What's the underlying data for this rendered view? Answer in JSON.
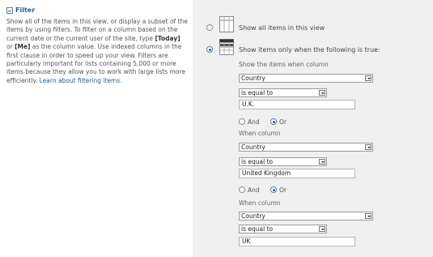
{
  "left": {
    "title": "Filter",
    "description_parts": [
      "Show all of the items in this view, or display a subset of the items by using filters. To filter on a column based on the current date or the current user of the site, type ",
      "[Today]",
      " or ",
      "[Me]",
      " as the column value. Use indexed columns in the first clause in order to speed up your view. Filters are particularly important for lists containing 5,000 or more items because they allow you to work with large lists more efficiently. "
    ],
    "link_text": "Learn about filtering items."
  },
  "options": {
    "show_all": "Show all items in this view",
    "show_filtered": "Show items only when the following is true:",
    "selected": "show_filtered"
  },
  "clauses": [
    {
      "label": "Show the items when column",
      "column": "Country",
      "operator": "is equal to",
      "value": "U.K.",
      "and_label": "And",
      "or_label": "Or",
      "logic": "Or"
    },
    {
      "label": "When column",
      "column": "Country",
      "operator": "is equal to",
      "value": "United Kingdom",
      "and_label": "And",
      "or_label": "Or",
      "logic": "Or"
    },
    {
      "label": "When column",
      "column": "Country",
      "operator": "is equal to",
      "value": "UK"
    }
  ],
  "icons": {
    "show_all": "list-grid-icon",
    "show_filtered": "filtered-grid-icon"
  }
}
